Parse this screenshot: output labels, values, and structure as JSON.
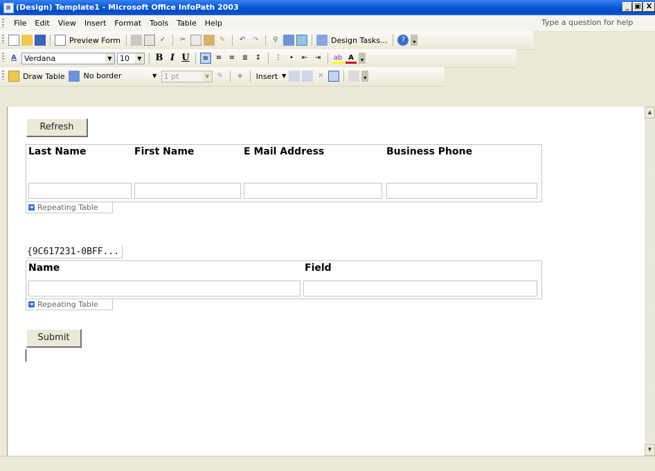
{
  "window": {
    "title": "(Design) Template1 - Microsoft Office InfoPath 2003",
    "min": "_",
    "max": "И",
    "close": "X"
  },
  "menu": {
    "items": [
      "File",
      "Edit",
      "View",
      "Insert",
      "Format",
      "Tools",
      "Table",
      "Help"
    ],
    "help_box": "Type a question for help"
  },
  "toolbar_standard": {
    "preview_label": "Preview Form",
    "design_tasks_label": "Design Tasks..."
  },
  "toolbar_format": {
    "font": "Verdana",
    "size": "10",
    "bold": "B",
    "italic": "I",
    "underline": "U",
    "font_color": "A"
  },
  "toolbar_table": {
    "draw_table": "Draw Table",
    "border": "No border",
    "weight": "1 pt",
    "insert": "Insert"
  },
  "form": {
    "refresh_button": "Refresh",
    "table1": {
      "headers": [
        "Last Name",
        "First Name",
        "E Mail Address",
        "Business Phone"
      ],
      "tag": "Repeating Table"
    },
    "guid_label": "{9C617231-0BFF...",
    "table2": {
      "headers": [
        "Name",
        "Field"
      ],
      "tag": "Repeating Table"
    },
    "submit_button": "Submit"
  }
}
